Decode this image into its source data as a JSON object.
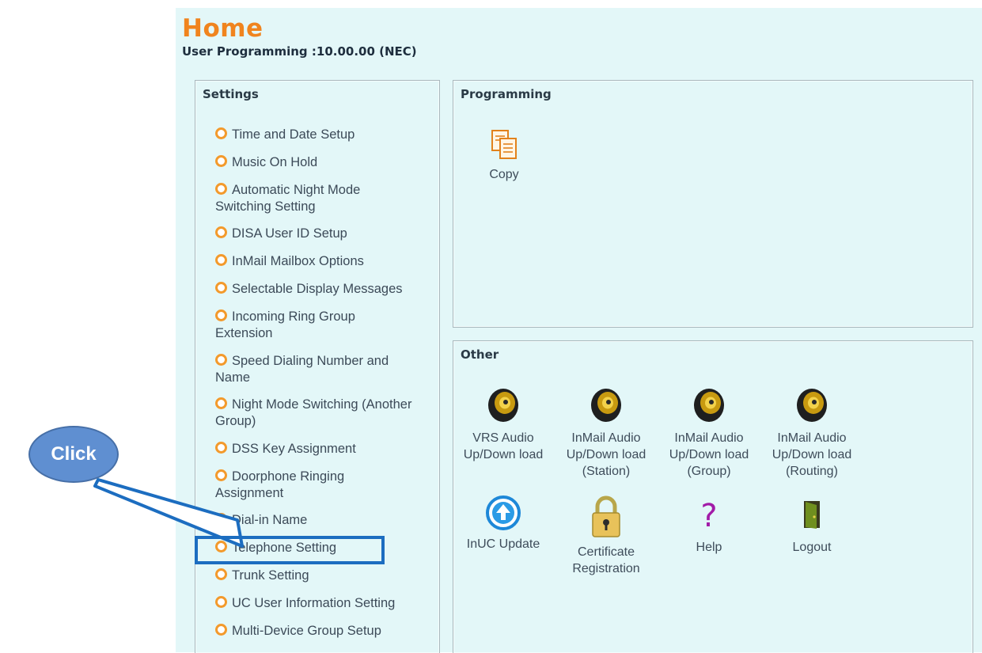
{
  "header": {
    "title": "Home",
    "subtitle": "User Programming :10.00.00 (NEC)"
  },
  "settings": {
    "title": "Settings",
    "items": [
      {
        "label": "Time and Date Setup"
      },
      {
        "label": "Music On Hold"
      },
      {
        "label": "Automatic Night Mode Switching Setting"
      },
      {
        "label": "DISA User ID Setup"
      },
      {
        "label": "InMail Mailbox Options"
      },
      {
        "label": "Selectable Display Messages"
      },
      {
        "label": "Incoming Ring Group Extension"
      },
      {
        "label": "Speed Dialing Number and Name"
      },
      {
        "label": "Night Mode Switching (Another Group)"
      },
      {
        "label": "DSS Key Assignment"
      },
      {
        "label": "Doorphone Ringing Assignment"
      },
      {
        "label": "Dial-in Name"
      },
      {
        "label": "Telephone Setting"
      },
      {
        "label": "Trunk Setting"
      },
      {
        "label": "UC User Information Setting"
      },
      {
        "label": "Multi-Device Group Setup"
      }
    ]
  },
  "programming": {
    "title": "Programming",
    "tools": [
      {
        "label": "Copy",
        "icon": "copy-icon"
      }
    ]
  },
  "other": {
    "title": "Other",
    "tools": [
      {
        "label": "VRS Audio Up/Down load",
        "icon": "speaker-icon"
      },
      {
        "label": "InMail Audio Up/Down load (Station)",
        "icon": "speaker-icon"
      },
      {
        "label": "InMail Audio Up/Down load (Group)",
        "icon": "speaker-icon"
      },
      {
        "label": "InMail Audio Up/Down load (Routing)",
        "icon": "speaker-icon"
      },
      {
        "label": "InUC Update",
        "icon": "upload-circle-icon"
      },
      {
        "label": "Certificate Registration",
        "icon": "padlock-icon"
      },
      {
        "label": "Help",
        "icon": "question-mark-icon"
      },
      {
        "label": "Logout",
        "icon": "exit-door-icon"
      }
    ]
  },
  "annotation": {
    "callout_label": "Click",
    "highlighted_item": "Telephone Setting"
  },
  "colors": {
    "background": "#e3f7f8",
    "title_orange": "#f0841e",
    "bullet_orange": "#f39a2c",
    "callout_blue": "#5f8fd1",
    "highlight_blue": "#1c6dc0"
  }
}
